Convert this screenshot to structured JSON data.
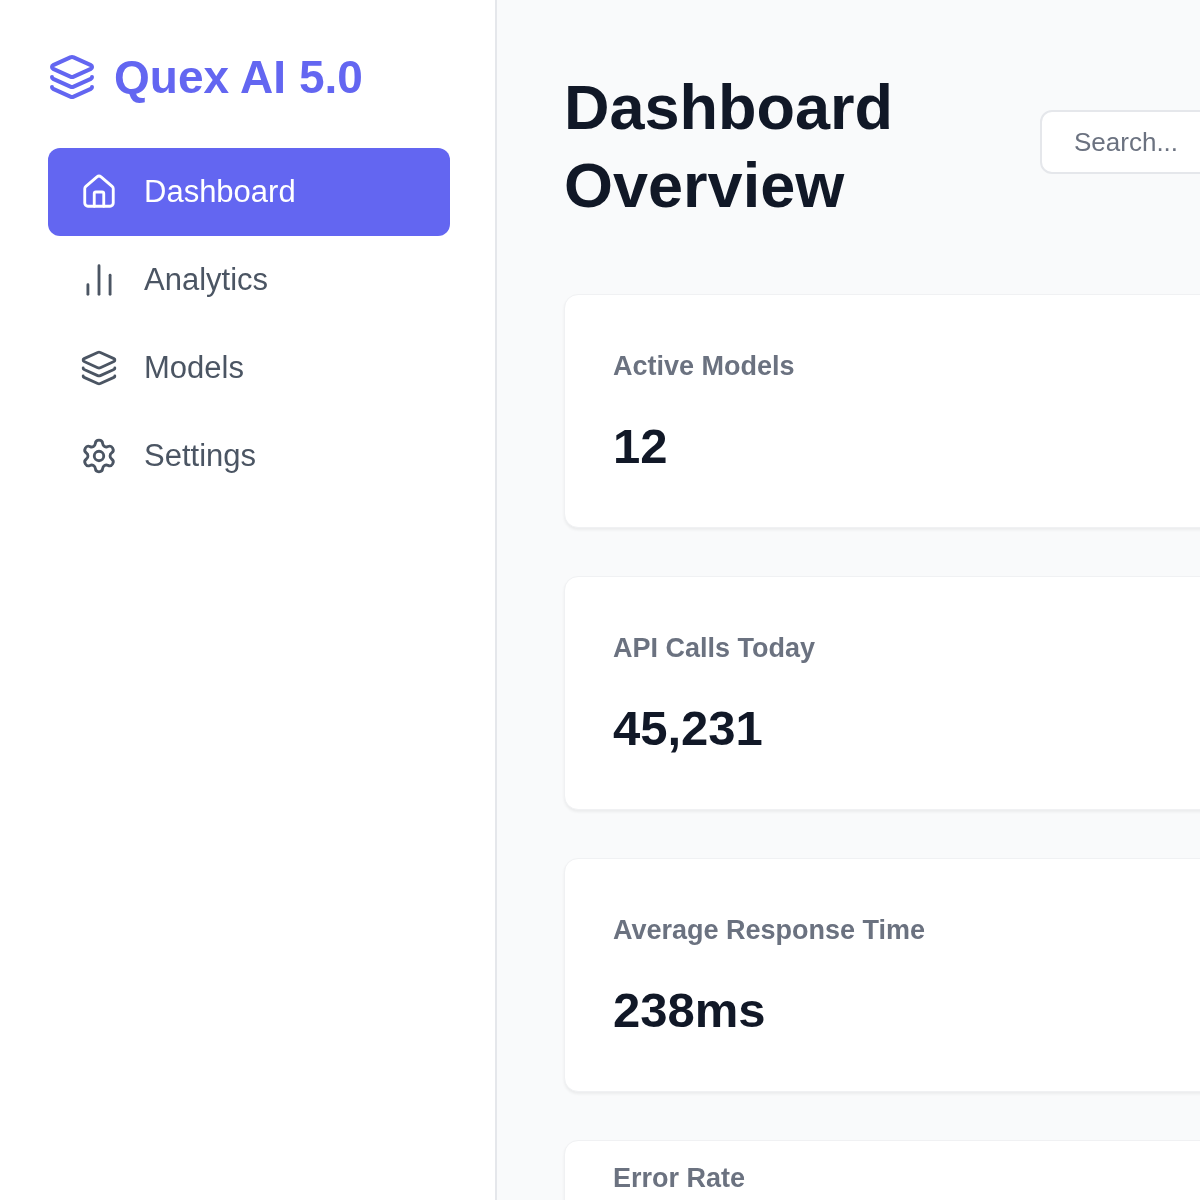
{
  "sidebar": {
    "logo": "Quex AI 5.0",
    "items": [
      {
        "label": "Dashboard",
        "selected": true
      },
      {
        "label": "Analytics",
        "selected": false
      },
      {
        "label": "Models",
        "selected": false
      },
      {
        "label": "Settings",
        "selected": false
      }
    ]
  },
  "header": {
    "title": "Dashboard Overview",
    "search": {
      "placeholder": "Search..."
    }
  },
  "cards": [
    {
      "label": "Active Models",
      "value": "12"
    },
    {
      "label": "API Calls Today",
      "value": "45,231"
    },
    {
      "label": "Average Response Time",
      "value": "238ms"
    },
    {
      "label": "Error Rate"
    }
  ]
}
